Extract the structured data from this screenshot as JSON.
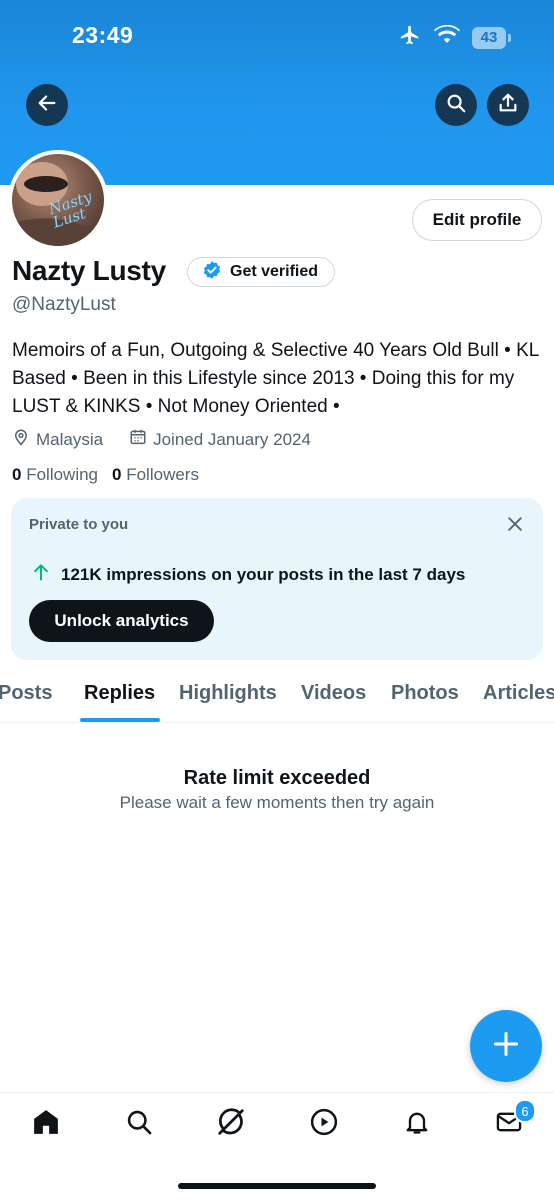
{
  "status_bar": {
    "time": "23:49",
    "battery": "43"
  },
  "header": {
    "back_icon": "back-arrow-icon",
    "search_icon": "search-icon",
    "share_icon": "share-icon"
  },
  "profile": {
    "avatar_signature": "Nasty Lust",
    "edit_label": "Edit profile",
    "name": "Nazty Lusty",
    "verify_label": "Get verified",
    "handle": "@NaztyLust",
    "bio": "Memoirs of a Fun, Outgoing & Selective 40 Years Old Bull • KL Based • Been in this Lifestyle since 2013 • Doing this for my LUST & KINKS • Not Money Oriented •",
    "location": "Malaysia",
    "joined": "Joined January 2024",
    "following_count": "0",
    "following_label": "Following",
    "followers_count": "0",
    "followers_label": "Followers"
  },
  "analytics_card": {
    "title": "Private to you",
    "impressions": "121K impressions on your posts in the last 7 days",
    "button_label": "Unlock analytics",
    "accent_color": "#00ba7c"
  },
  "tabs": [
    {
      "label": "Posts"
    },
    {
      "label": "Replies"
    },
    {
      "label": "Highlights"
    },
    {
      "label": "Videos"
    },
    {
      "label": "Photos"
    },
    {
      "label": "Articles"
    }
  ],
  "active_tab": "Replies",
  "empty_state": {
    "title": "Rate limit exceeded",
    "subtitle": "Please wait a few moments then try again"
  },
  "bottom_nav": {
    "items": [
      "home-icon",
      "search-icon",
      "grok-icon",
      "video-play-icon",
      "bell-icon",
      "mail-icon"
    ],
    "mail_badge": "6"
  },
  "colors": {
    "brand": "#1d9bf0",
    "text": "#0f1419",
    "secondary": "#536471",
    "card_bg": "#e8f5fd"
  }
}
